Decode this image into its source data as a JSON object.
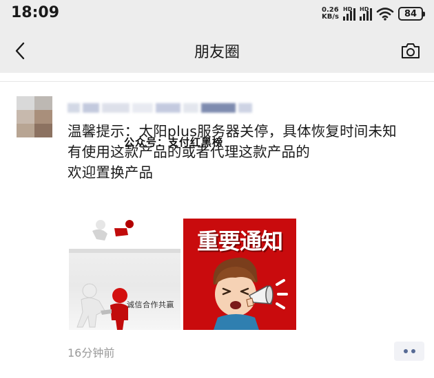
{
  "status_bar": {
    "time": "18:09",
    "net_speed_value": "0.26",
    "net_speed_unit": "KB/s",
    "signal_label": "HD",
    "battery": "84"
  },
  "nav": {
    "title": "朋友圈",
    "back_icon": "chevron-left-icon",
    "camera_icon": "camera-icon"
  },
  "post": {
    "text": "温馨提示：太阳plus服务器关停，具体恢复时间未知\n有使用这款产品的或者代理这款产品的\n欢迎置换产品",
    "watermark": "公众号：支付红黑榜",
    "images": [
      {
        "caption": "诚信合作共赢",
        "icon": "handshake-figures-image"
      },
      {
        "headline": "重要通知",
        "icon": "megaphone-cartoon-image"
      }
    ],
    "timestamp": "16分钟前"
  },
  "colors": {
    "nav_background": "#ededed",
    "notice_red": "#c90b0d",
    "link_blue": "#576b95",
    "timestamp_grey": "#9a9a9a"
  }
}
